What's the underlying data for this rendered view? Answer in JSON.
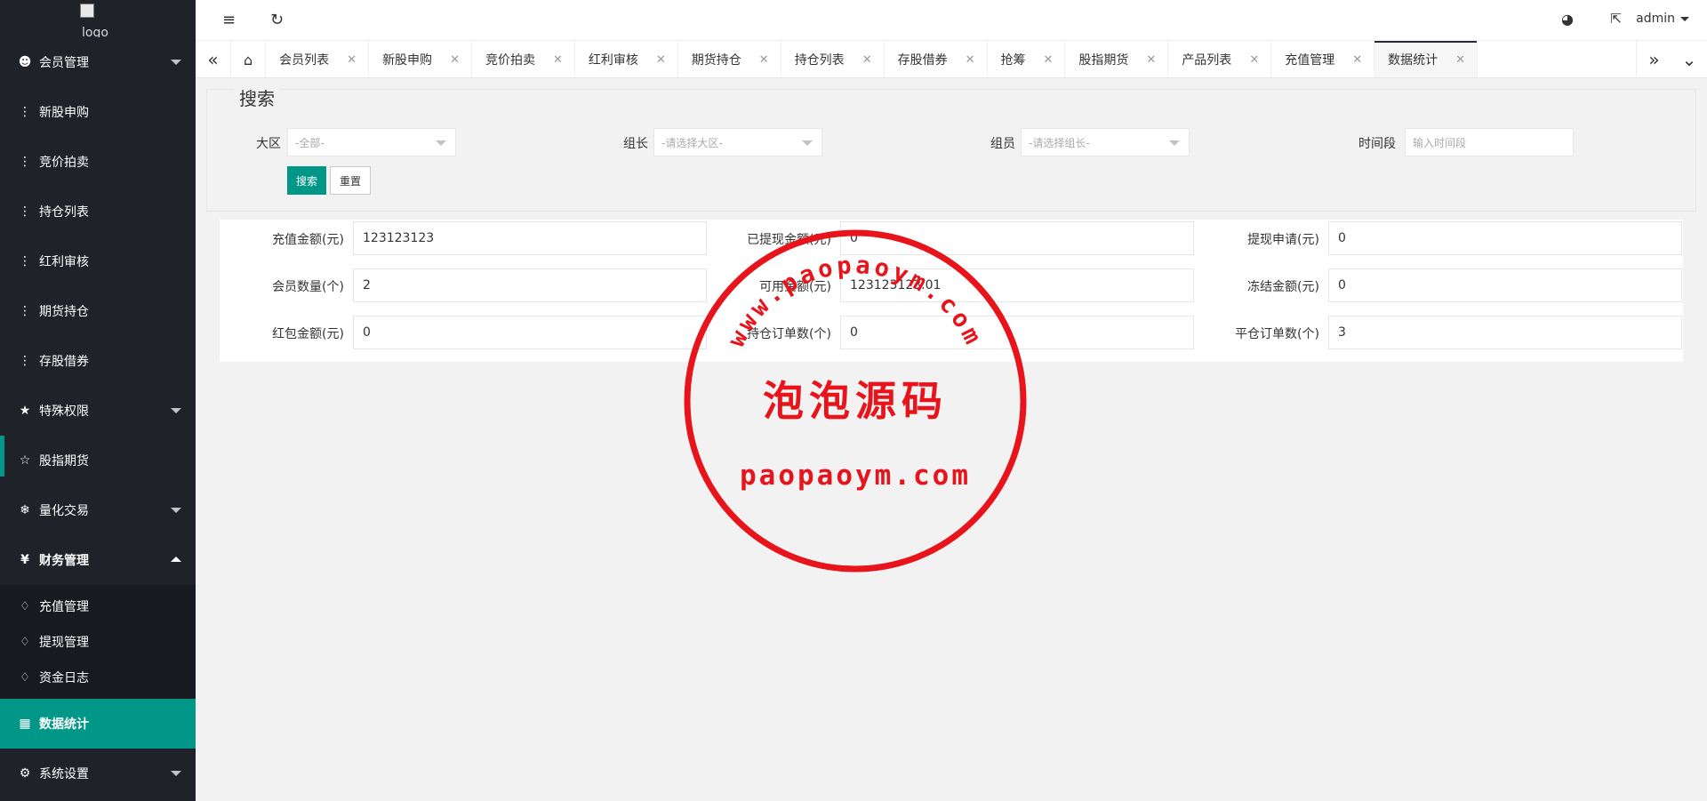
{
  "sidebar": {
    "logo_alt": "logo",
    "items": [
      {
        "label": "会员管理",
        "icon": "user-icon"
      },
      {
        "label": "新股申购",
        "icon": "dots-icon"
      },
      {
        "label": "竞价拍卖",
        "icon": "dots-icon"
      },
      {
        "label": "持仓列表",
        "icon": "dots-icon"
      },
      {
        "label": "红利审核",
        "icon": "dots-icon"
      },
      {
        "label": "期货持仓",
        "icon": "dots-icon"
      },
      {
        "label": "存股借券",
        "icon": "dots-icon"
      },
      {
        "label": "特殊权限",
        "icon": "star-icon"
      },
      {
        "label": "股指期货",
        "icon": "star-outline-icon"
      },
      {
        "label": "量化交易",
        "icon": "snowflake-icon"
      },
      {
        "label": "财务管理",
        "icon": "yen-icon"
      },
      {
        "label": "数据统计",
        "icon": "calendar-icon"
      },
      {
        "label": "系统设置",
        "icon": "gear-icon"
      }
    ],
    "finance_sub": [
      {
        "label": "充值管理",
        "icon": "diamond-icon"
      },
      {
        "label": "提现管理",
        "icon": "diamond-icon"
      },
      {
        "label": "资金日志",
        "icon": "diamond-icon"
      }
    ]
  },
  "header": {
    "user": "admin"
  },
  "tabs": [
    {
      "label": "会员列表"
    },
    {
      "label": "新股申购"
    },
    {
      "label": "竞价拍卖"
    },
    {
      "label": "红利审核"
    },
    {
      "label": "期货持仓"
    },
    {
      "label": "持仓列表"
    },
    {
      "label": "存股借券"
    },
    {
      "label": "抢筹"
    },
    {
      "label": "股指期货"
    },
    {
      "label": "产品列表"
    },
    {
      "label": "充值管理"
    },
    {
      "label": "数据统计"
    }
  ],
  "search": {
    "legend": "搜索",
    "region_label": "大区",
    "region_value": "-全部-",
    "leader_label": "组长",
    "leader_value": "-请选择大区-",
    "member_label": "组员",
    "member_value": "-请选择组长-",
    "period_label": "时间段",
    "period_placeholder": "输入时间段",
    "search_btn": "搜索",
    "reset_btn": "重置"
  },
  "stats": {
    "recharge_label": "充值金额(元)",
    "recharge_value": "123123123",
    "withdrawn_label": "已提现金额(元)",
    "withdrawn_value": "0",
    "withdraw_req_label": "提现申请(元)",
    "withdraw_req_value": "0",
    "members_label": "会员数量(个)",
    "members_value": "2",
    "available_label": "可用金额(元)",
    "available_value": "123123123.01",
    "frozen_label": "冻结金额(元)",
    "frozen_value": "0",
    "redpacket_label": "红包金额(元)",
    "redpacket_value": "0",
    "open_orders_label": "持仓订单数(个)",
    "open_orders_value": "0",
    "closed_orders_label": "平仓订单数(个)",
    "closed_orders_value": "3"
  },
  "stamp": {
    "arc_text": "www.paopaoym.com",
    "center_text": "泡泡源码",
    "bottom_text": "paopaoym.com",
    "color": "#e8141b"
  }
}
